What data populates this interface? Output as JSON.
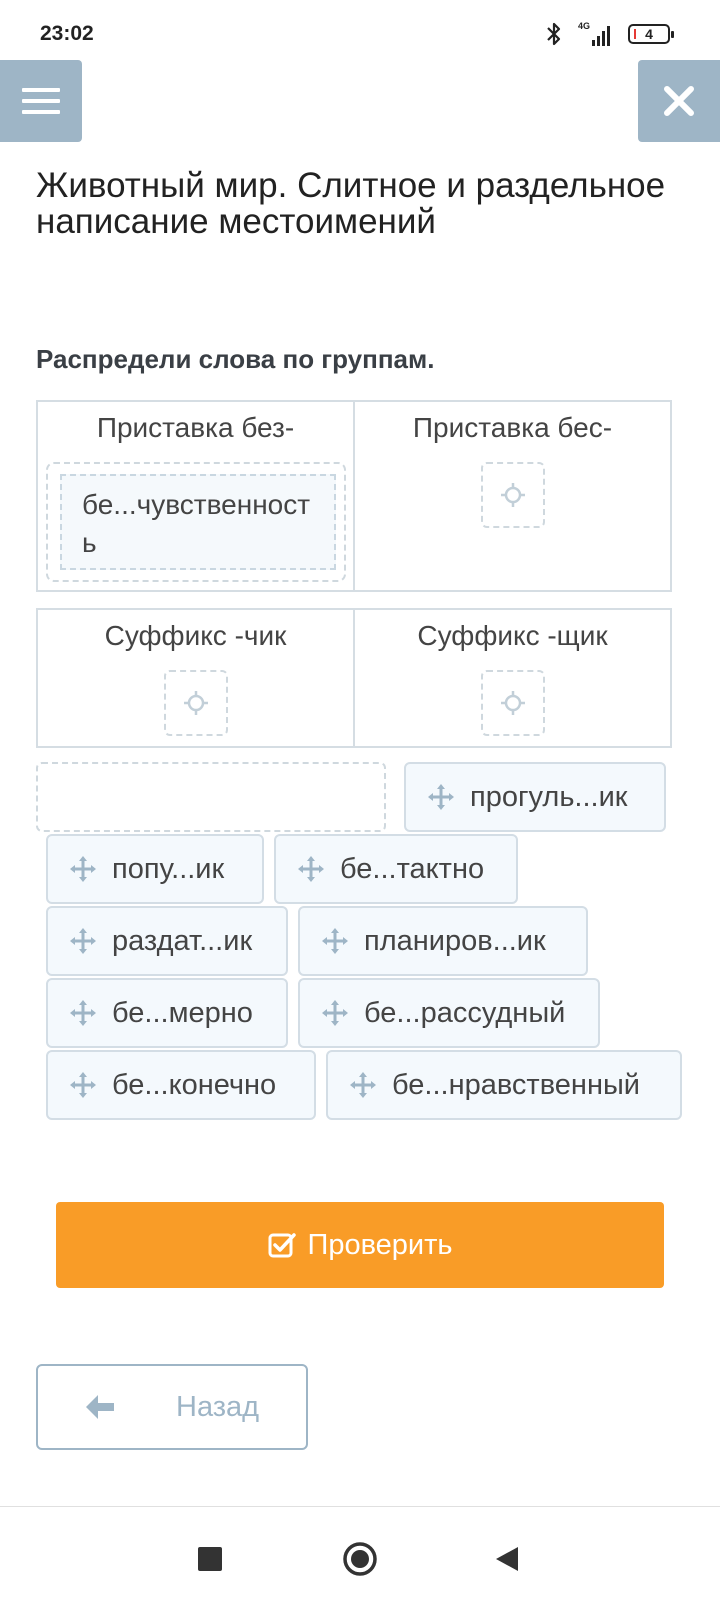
{
  "status": {
    "time": "23:02",
    "network": "4G",
    "battery": "4"
  },
  "header": {
    "title": "Животный мир. Слитное и раздельное написание местоимений",
    "menu_icon": "hamburger-icon",
    "close_icon": "close-icon"
  },
  "task": {
    "instruction": "Распредели слова по группам."
  },
  "groups": [
    {
      "label": "Приставка без-",
      "items": [
        "бе...чувственность"
      ]
    },
    {
      "label": "Приставка бес-",
      "items": []
    },
    {
      "label": "Суффикс -чик",
      "items": []
    },
    {
      "label": "Суффикс -щик",
      "items": []
    }
  ],
  "bank": [
    "прогуль...ик",
    "попу...ик",
    "бе...тактно",
    "раздат...ик",
    "планиров...ик",
    "бе...мерно",
    "бе...рассудный",
    "бе...конечно",
    "бе...нравственный"
  ],
  "buttons": {
    "check": "Проверить",
    "back": "Назад"
  },
  "colors": {
    "accent": "#f99c27",
    "header_buttons": "#9eb5c6",
    "chip_bg": "#f4f9fd"
  }
}
